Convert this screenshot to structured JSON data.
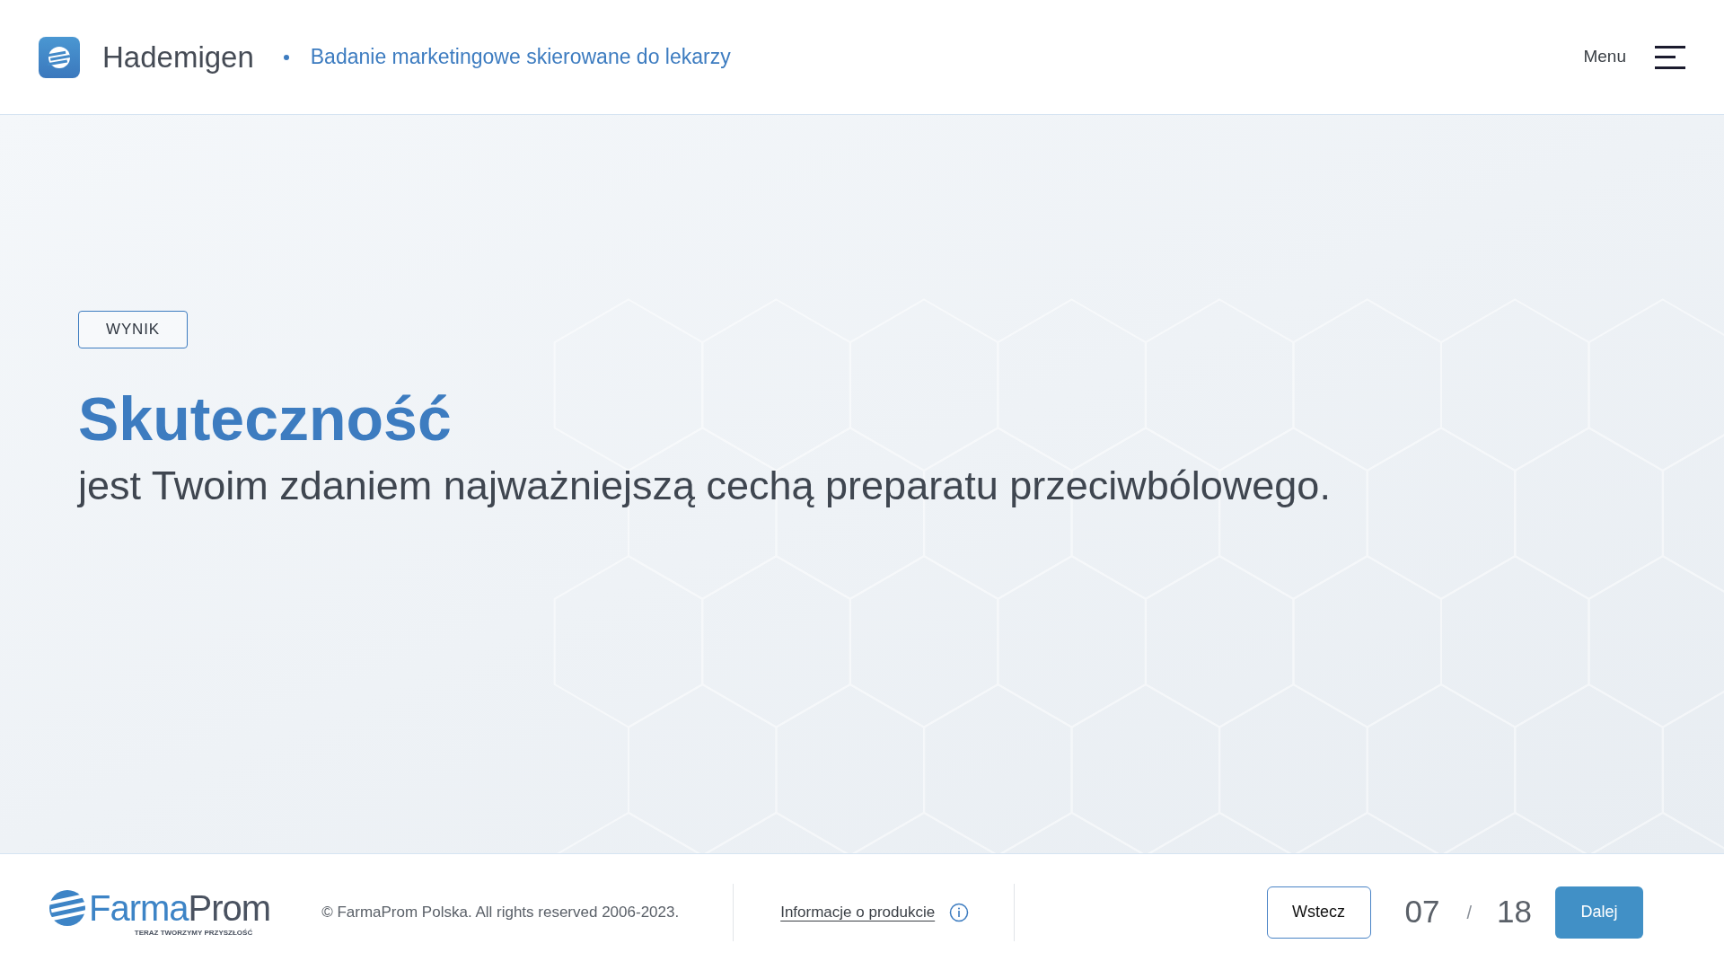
{
  "header": {
    "app_name": "Hademigen",
    "subtitle": "Badanie marketingowe skierowane do lekarzy",
    "menu_label": "Menu"
  },
  "content": {
    "badge": "WYNIK",
    "heading": "Skuteczność",
    "statement": "jest Twoim zdaniem najważniejszą cechą preparatu przeciwbólowego."
  },
  "footer": {
    "brand_first": "Farma",
    "brand_second": "Prom",
    "tagline": "TERAZ TWORZYMY PRZYSZŁOŚĆ",
    "copyright": "© FarmaProm Polska. All rights reserved 2006-2023.",
    "info_link": "Informacje o produkcie",
    "back_button": "Wstecz",
    "current_page": "07",
    "separator": "/",
    "total_pages": "18",
    "next_button": "Dalej"
  }
}
